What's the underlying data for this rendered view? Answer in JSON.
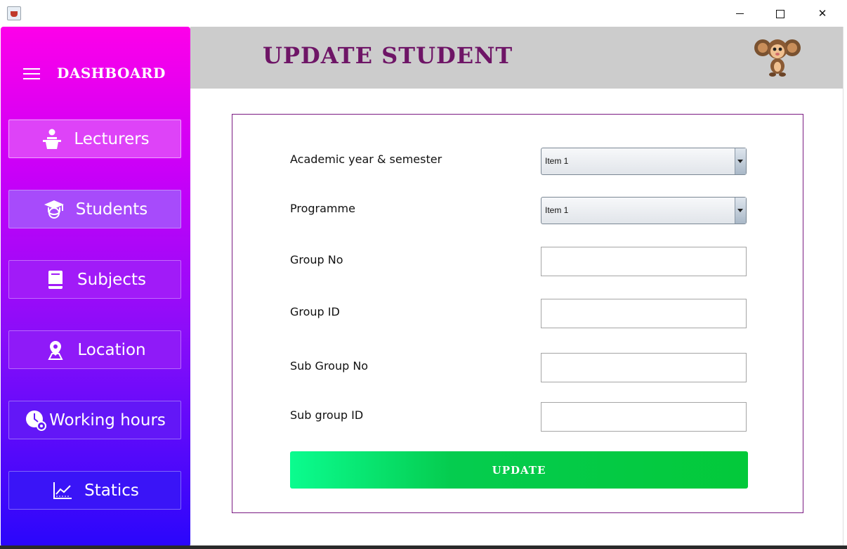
{
  "window": {
    "controls": {
      "minimize": "minimize",
      "maximize": "maximize",
      "close": "close"
    }
  },
  "sidebar": {
    "title": "DASHBOARD",
    "items": [
      {
        "label": "Lecturers",
        "icon": "lecturer-icon",
        "active": true
      },
      {
        "label": "Students",
        "icon": "graduate-icon",
        "active": false
      },
      {
        "label": "Subjects",
        "icon": "book-icon",
        "active": false
      },
      {
        "label": "Location",
        "icon": "location-pin-icon",
        "active": false
      },
      {
        "label": "Working hours",
        "icon": "clock-gear-icon",
        "active": false
      },
      {
        "label": "Statics",
        "icon": "line-chart-icon",
        "active": false
      }
    ]
  },
  "header": {
    "title": "UPDATE STUDENT",
    "mascot": "monkey-mascot-icon"
  },
  "form": {
    "academic_year_label": "Academic year & semester",
    "academic_year_value": "Item 1",
    "programme_label": "Programme",
    "programme_value": "Item 1",
    "group_no_label": "Group No",
    "group_no_value": "",
    "group_id_label": "Group ID",
    "group_id_value": "",
    "sub_group_no_label": "Sub Group No",
    "sub_group_no_value": "",
    "sub_group_id_label": "Sub group ID",
    "sub_group_id_value": "",
    "submit_label": "UPDATE"
  },
  "colors": {
    "title": "#6e1566",
    "panel_border": "#7a1a82",
    "button_green": "#03c93a",
    "header_bg": "#cccccc"
  }
}
